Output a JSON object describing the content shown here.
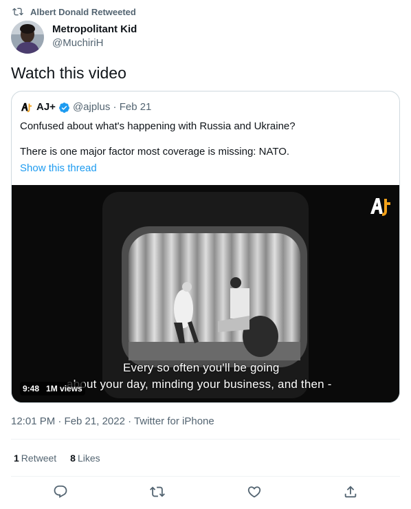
{
  "retweet_header": {
    "text": "Albert Donald Retweeted",
    "icon": "retweet-icon"
  },
  "author": {
    "display_name": "Metropolitant Kid",
    "handle": "@MuchiriH"
  },
  "tweet": {
    "text": "Watch this video"
  },
  "quote": {
    "name": "AJ+",
    "handle": "@ajplus",
    "separator": "·",
    "date": "Feb 21",
    "line1": "Confused about what's happening with Russia and Ukraine?",
    "line2": "There is one major factor most coverage is missing: NATO.",
    "show_thread": "Show this thread",
    "video": {
      "caption_line1": "Every so often you'll be going",
      "caption_line2": "about your day, minding your business, and then -",
      "duration": "9:48",
      "views": "1M views"
    }
  },
  "timestamp": "12:01 PM · Feb 21, 2022 · Twitter for iPhone",
  "stats": {
    "retweets_count": "1",
    "retweets_label": "Retweet",
    "likes_count": "8",
    "likes_label": "Likes"
  },
  "colors": {
    "link": "#1d9bf0",
    "secondary_text": "#536471",
    "border": "#cfd9de"
  }
}
